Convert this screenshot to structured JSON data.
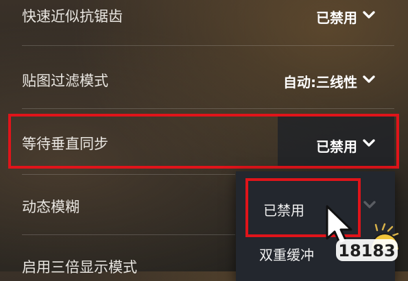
{
  "settings": [
    {
      "label": "快速近似抗锯齿",
      "value": "已禁用"
    },
    {
      "label": "贴图过滤模式",
      "value": "自动:三线性"
    },
    {
      "label": "等待垂直同步",
      "value": "已禁用"
    },
    {
      "label": "动态模糊",
      "value": ""
    },
    {
      "label": "启用三倍显示模式",
      "value": ""
    }
  ],
  "dropdown": {
    "options": [
      "已禁用",
      "双重缓冲"
    ],
    "selected": "已禁用"
  },
  "watermark": {
    "text": "18183"
  },
  "colors": {
    "highlight": "#e0141a",
    "panel": "#23272e"
  }
}
